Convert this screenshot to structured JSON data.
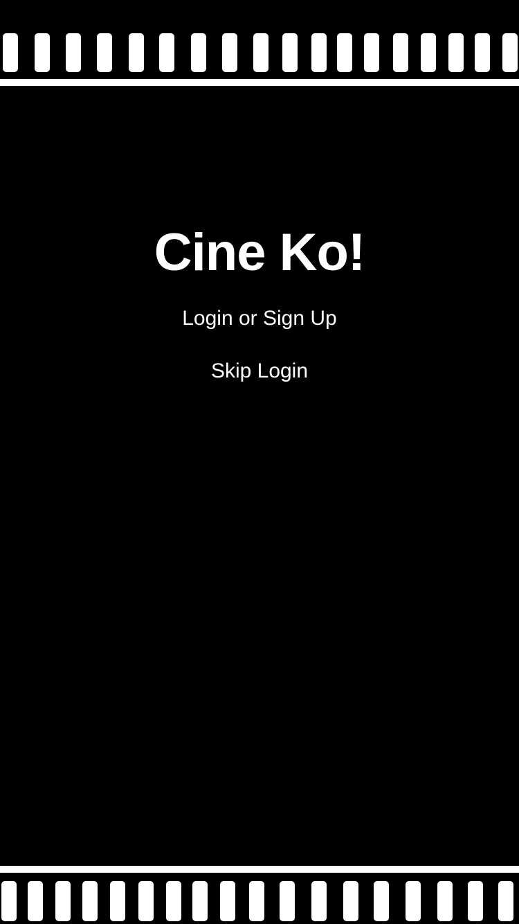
{
  "app": {
    "title": "Cine Ko!"
  },
  "actions": {
    "login_label": "Login or Sign Up",
    "skip_label": "Skip Login"
  },
  "colors": {
    "background": "#000000",
    "foreground": "#ffffff"
  }
}
